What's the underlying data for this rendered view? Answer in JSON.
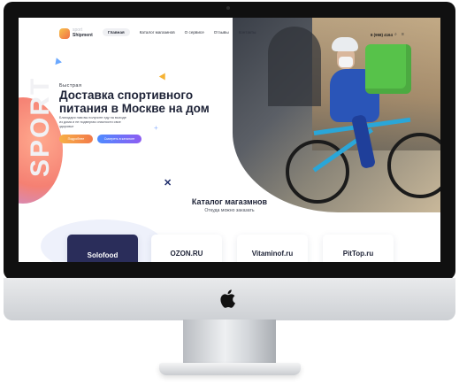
{
  "header": {
    "logo_top": "sport",
    "logo_bottom": "Shipment",
    "nav": [
      "Главная",
      "Каталог магазинов",
      "О сервисе",
      "Отзывы",
      "Контакты"
    ],
    "phone": "8 (958) 4164"
  },
  "hero": {
    "kicker": "Быстрая",
    "title": "Доставка спортивного питания в Москве на дом",
    "description": "Благодаря нам вы получите еду на выходе из дома и не подвергая опасности свое здоровье",
    "button_primary": "Подробнее",
    "button_secondary": "Смотреть в каталоге"
  },
  "catalog": {
    "title": "Каталог магазмнов",
    "subtitle": "Откуда можно заказать",
    "stores": [
      "Solofood",
      "OZON.RU",
      "Vitaminof.ru",
      "PitTop.ru"
    ]
  },
  "decor": {
    "vertical_text": "SPORT"
  },
  "colors": {
    "accent_orange": "#f5a442",
    "accent_blue": "#5b7cfa",
    "dark_navy": "#1d2236"
  },
  "icons": [
    "logo-badge-icon",
    "search-icon",
    "menu-icon",
    "apple-logo-icon"
  ]
}
